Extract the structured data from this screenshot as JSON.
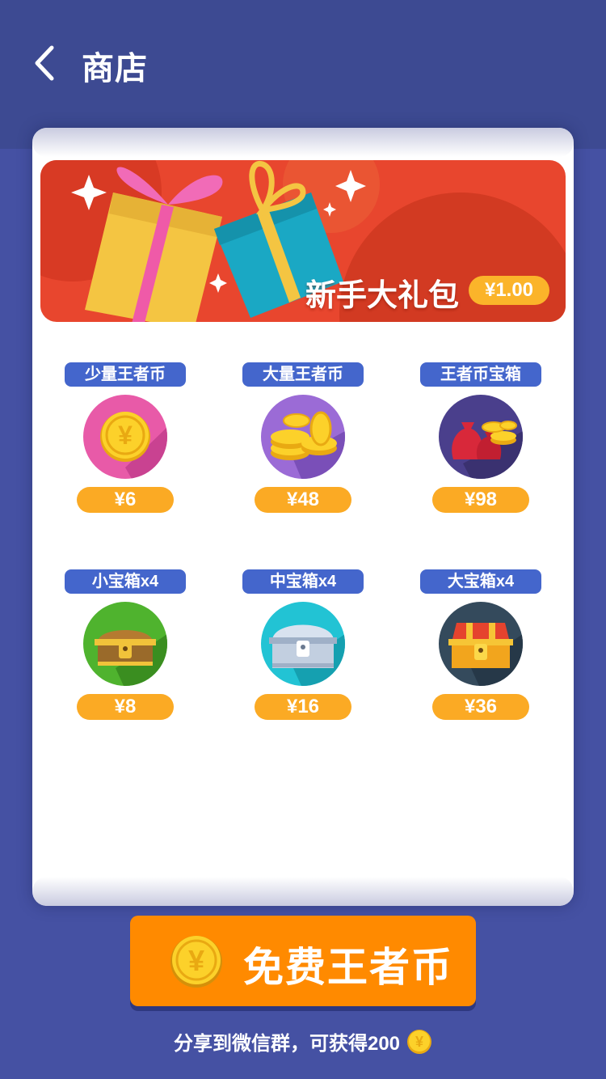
{
  "header": {
    "title": "商店",
    "back_icon": "chevron-left-icon"
  },
  "banner": {
    "title": "新手大礼包",
    "price": "¥1.00",
    "image": "gift-boxes"
  },
  "items": [
    {
      "label": "少量王者币",
      "price": "¥6",
      "icon": "single-coin-icon"
    },
    {
      "label": "大量王者币",
      "price": "¥48",
      "icon": "coin-pile-icon"
    },
    {
      "label": "王者币宝箱",
      "price": "¥98",
      "icon": "money-bags-icon"
    },
    {
      "label": "小宝箱x4",
      "price": "¥8",
      "icon": "small-chest-icon"
    },
    {
      "label": "中宝箱x4",
      "price": "¥16",
      "icon": "medium-chest-icon"
    },
    {
      "label": "大宝箱x4",
      "price": "¥36",
      "icon": "large-chest-icon"
    }
  ],
  "free_button": {
    "label": "免费王者币",
    "icon": "coin-icon"
  },
  "share": {
    "text": "分享到微信群，可获得200",
    "icon": "coin-icon"
  },
  "colors": {
    "background": "#4551a3",
    "header": "#3d4a92",
    "accent_orange": "#ff8a00",
    "price_pill": "#fbaa24",
    "label_blue": "#4466cc",
    "banner_red": "#e8462e"
  }
}
